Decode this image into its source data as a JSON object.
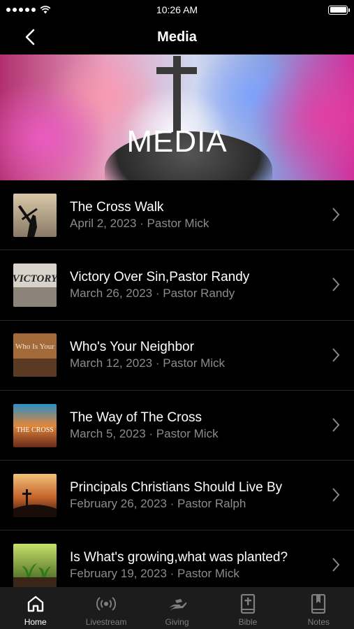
{
  "status_bar": {
    "time": "10:26 AM"
  },
  "nav": {
    "title": "Media"
  },
  "hero": {
    "title": "MEDIA"
  },
  "media_items": [
    {
      "title": "The Cross Walk",
      "subtitle": "April 2, 2023 · Pastor Mick",
      "thumb_text": ""
    },
    {
      "title": "Victory Over Sin,Pastor Randy",
      "subtitle": "March 26, 2023 · Pastor Randy",
      "thumb_text": "VICTORY"
    },
    {
      "title": "Who's Your Neighbor",
      "subtitle": "March 12, 2023 · Pastor Mick",
      "thumb_text": "Who Is Your"
    },
    {
      "title": "The Way of The Cross",
      "subtitle": "March 5, 2023 · Pastor Mick",
      "thumb_text": "THE CROSS"
    },
    {
      "title": "Principals Christians Should Live By",
      "subtitle": "February 26, 2023 · Pastor Ralph",
      "thumb_text": ""
    },
    {
      "title": "Is What's growing,what was planted?",
      "subtitle": "February 19, 2023 · Pastor Mick",
      "thumb_text": ""
    }
  ],
  "tabs": [
    {
      "label": "Home",
      "icon": "home-icon"
    },
    {
      "label": "Livestream",
      "icon": "broadcast-icon"
    },
    {
      "label": "Giving",
      "icon": "giving-hand-icon"
    },
    {
      "label": "Bible",
      "icon": "bible-icon"
    },
    {
      "label": "Notes",
      "icon": "notes-icon"
    }
  ],
  "colors": {
    "accent": "#ffffff",
    "inactive": "#7e7e7e",
    "tabbar_bg": "#1c1c1c"
  }
}
